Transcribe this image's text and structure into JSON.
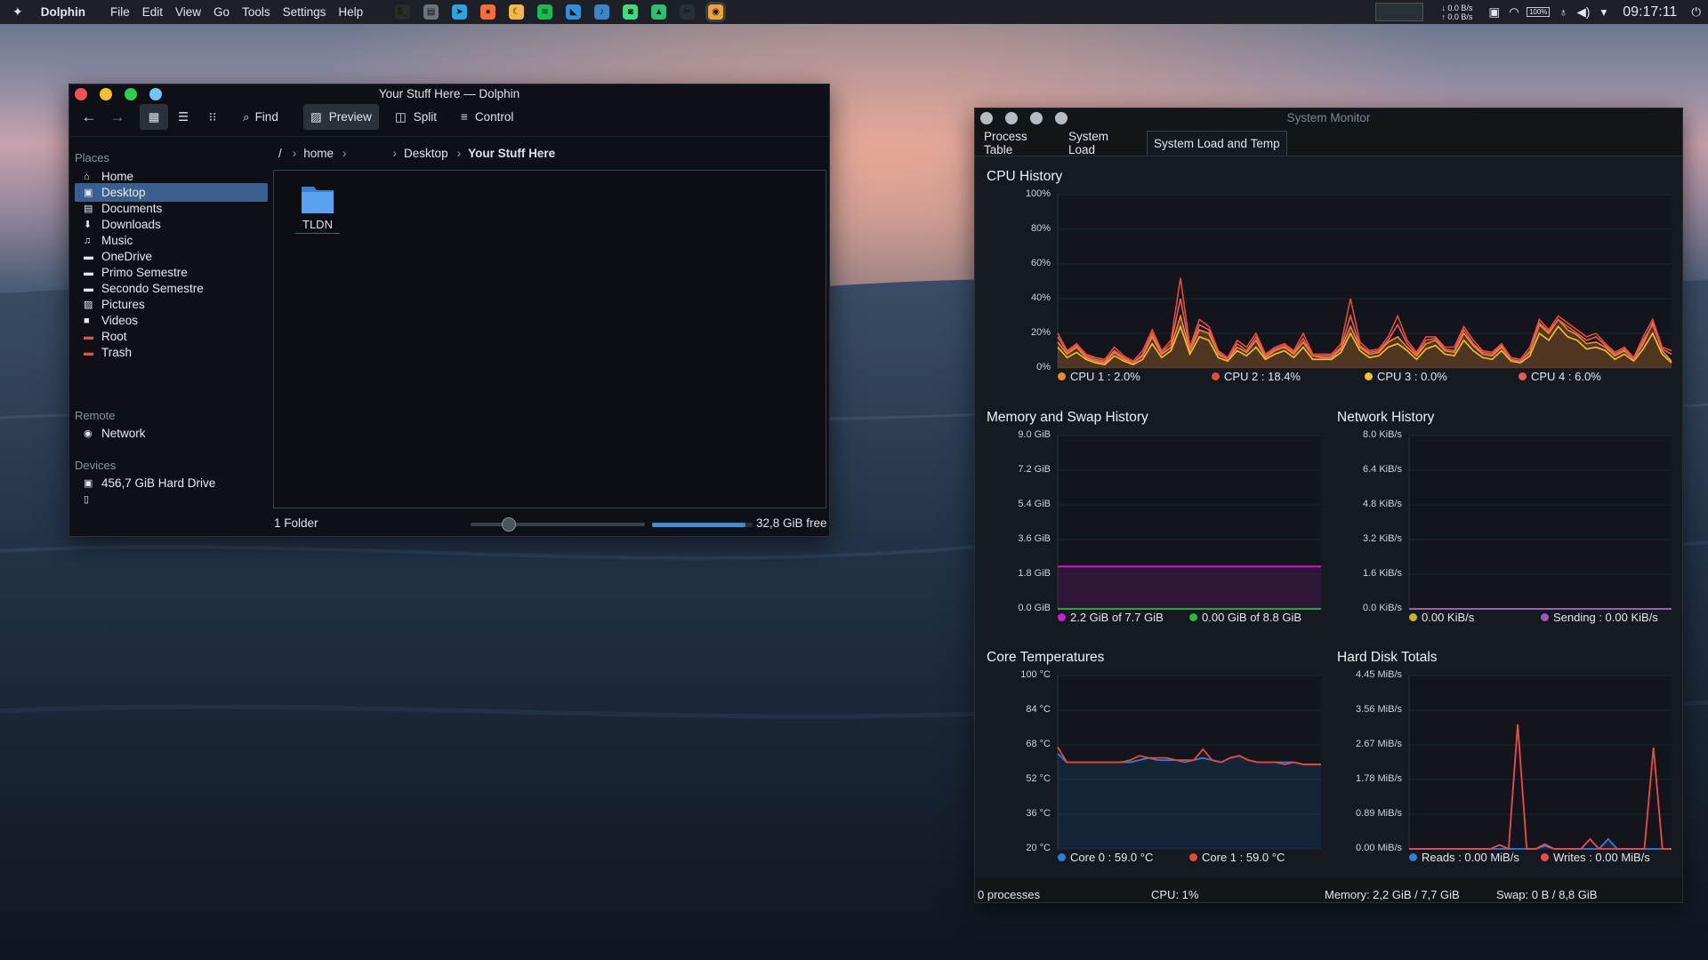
{
  "panel": {
    "app_name": "Dolphin",
    "menu": [
      "File",
      "Edit",
      "View",
      "Go",
      "Tools",
      "Settings",
      "Help"
    ],
    "net_down": "0.0 B/s",
    "net_up": "0.0 B/s",
    "battery": "100%",
    "clock": "09:17:11",
    "apps": [
      {
        "name": "terminal-icon",
        "color": "#2b2b2b",
        "glyph": "$_"
      },
      {
        "name": "files-icon",
        "color": "#6c737d",
        "glyph": "▤"
      },
      {
        "name": "telegram-icon",
        "color": "#2fa3df",
        "glyph": "➤"
      },
      {
        "name": "firefox-icon",
        "color": "#ff6b35",
        "glyph": "●"
      },
      {
        "name": "night-light-icon",
        "color": "#f2b84b",
        "glyph": "☾"
      },
      {
        "name": "spotify-icon",
        "color": "#1db954",
        "glyph": "≋"
      },
      {
        "name": "vscode-icon",
        "color": "#2f8fe0",
        "glyph": "◣"
      },
      {
        "name": "music-app-icon",
        "color": "#3a86c8",
        "glyph": "♪"
      },
      {
        "name": "android-icon",
        "color": "#3ddc84",
        "glyph": "◙"
      },
      {
        "name": "image-viewer-icon",
        "color": "#2fbf71",
        "glyph": "▲"
      },
      {
        "name": "scissors-icon",
        "color": "#2a2f36",
        "glyph": "✂"
      },
      {
        "name": "ubuntu-icon",
        "color": "#f0a23a",
        "glyph": "◉"
      }
    ]
  },
  "dolphin": {
    "title": "Your Stuff Here — Dolphin",
    "toolbar": {
      "find": "Find",
      "preview": "Preview",
      "split": "Split",
      "control": "Control"
    },
    "breadcrumb": [
      "/",
      "home",
      "Desktop",
      "Your Stuff Here"
    ],
    "places_header": "Places",
    "places": [
      {
        "label": "Home",
        "icon": "home-icon",
        "color": "#e6e9ed"
      },
      {
        "label": "Desktop",
        "icon": "desktop-icon",
        "color": "#e6e9ed"
      },
      {
        "label": "Documents",
        "icon": "document-icon",
        "color": "#e6e9ed"
      },
      {
        "label": "Downloads",
        "icon": "download-icon",
        "color": "#e6e9ed"
      },
      {
        "label": "Music",
        "icon": "music-icon",
        "color": "#e6e9ed"
      },
      {
        "label": "OneDrive",
        "icon": "folder-icon",
        "color": "#e6e9ed"
      },
      {
        "label": "Primo Semestre",
        "icon": "folder-icon",
        "color": "#e6e9ed"
      },
      {
        "label": "Secondo Semestre",
        "icon": "folder-icon",
        "color": "#e6e9ed"
      },
      {
        "label": "Pictures",
        "icon": "pictures-icon",
        "color": "#e6e9ed"
      },
      {
        "label": "Videos",
        "icon": "video-icon",
        "color": "#e6e9ed"
      },
      {
        "label": "Root",
        "icon": "root-folder-icon",
        "color": "#e0504a"
      },
      {
        "label": "Trash",
        "icon": "trash-icon",
        "color": "#e0504a"
      }
    ],
    "remote_header": "Remote",
    "remote": [
      {
        "label": "Network",
        "icon": "network-icon"
      }
    ],
    "devices_header": "Devices",
    "devices": [
      {
        "label": "456,7 GiB Hard Drive",
        "icon": "hard-drive-icon"
      },
      {
        "label": "",
        "icon": "removable-device-icon"
      }
    ],
    "files": [
      {
        "name": "TLDN",
        "type": "folder"
      }
    ],
    "status": {
      "count": "1 Folder",
      "free": "32,8 GiB free",
      "zoom_fraction": 0.22,
      "disk_used_fraction": 0.93
    }
  },
  "monitor": {
    "title": "System Monitor",
    "tabs": [
      "Process Table",
      "System Load",
      "System Load and Temp"
    ],
    "active_tab": 2,
    "status": {
      "processes": "0 processes",
      "cpu": "CPU: 1%",
      "memory": "Memory: 2,2 GiB / 7,7 GiB",
      "swap": "Swap: 0 B / 8,8 GiB"
    }
  },
  "chart_data": [
    {
      "type": "line",
      "title": "CPU History",
      "y_ticks": [
        "100%",
        "80%",
        "60%",
        "40%",
        "20%",
        "0%"
      ],
      "ylim": [
        0,
        100
      ],
      "series": [
        {
          "name": "CPU 1 : 2.0%",
          "color": "#f08d2a",
          "values": [
            15,
            8,
            12,
            6,
            4,
            3,
            9,
            5,
            3,
            7,
            18,
            8,
            12,
            30,
            10,
            22,
            20,
            8,
            5,
            12,
            9,
            16,
            6,
            10,
            12,
            8,
            15,
            7,
            6,
            6,
            11,
            24,
            12,
            8,
            9,
            15,
            18,
            12,
            7,
            14,
            16,
            10,
            9,
            20,
            13,
            8,
            7,
            12,
            5,
            4,
            9,
            25,
            20,
            28,
            22,
            19,
            14,
            15,
            12,
            7,
            10,
            5,
            14,
            26,
            10,
            4
          ]
        },
        {
          "name": "CPU 2 : 18.4%",
          "color": "#e84a3a",
          "values": [
            20,
            10,
            14,
            8,
            6,
            5,
            12,
            7,
            4,
            10,
            22,
            10,
            16,
            52,
            12,
            28,
            24,
            10,
            6,
            16,
            12,
            20,
            8,
            12,
            14,
            10,
            20,
            8,
            8,
            8,
            14,
            40,
            15,
            10,
            11,
            18,
            30,
            16,
            9,
            18,
            18,
            12,
            12,
            24,
            16,
            10,
            9,
            14,
            6,
            5,
            12,
            28,
            22,
            30,
            26,
            22,
            18,
            20,
            14,
            9,
            12,
            6,
            18,
            28,
            12,
            10
          ]
        },
        {
          "name": "CPU 3 : 0.0%",
          "color": "#f2c32b",
          "values": [
            12,
            6,
            9,
            5,
            3,
            2,
            7,
            4,
            2,
            5,
            14,
            6,
            10,
            24,
            8,
            18,
            16,
            6,
            4,
            10,
            7,
            12,
            5,
            8,
            10,
            6,
            12,
            5,
            5,
            5,
            9,
            20,
            10,
            6,
            7,
            12,
            14,
            10,
            5,
            11,
            13,
            8,
            7,
            16,
            10,
            6,
            5,
            10,
            4,
            3,
            7,
            20,
            16,
            24,
            18,
            16,
            11,
            12,
            10,
            5,
            8,
            4,
            11,
            20,
            8,
            3
          ]
        },
        {
          "name": "CPU 4 : 6.0%",
          "color": "#f05a5a",
          "values": [
            18,
            9,
            13,
            7,
            5,
            4,
            10,
            6,
            3,
            8,
            20,
            9,
            14,
            40,
            11,
            25,
            22,
            9,
            5,
            14,
            10,
            18,
            7,
            11,
            13,
            9,
            17,
            7,
            7,
            7,
            12,
            30,
            13,
            9,
            10,
            16,
            25,
            14,
            8,
            16,
            17,
            11,
            10,
            22,
            14,
            9,
            8,
            13,
            5,
            4,
            10,
            26,
            21,
            28,
            24,
            20,
            16,
            18,
            13,
            8,
            11,
            5,
            16,
            25,
            11,
            8
          ]
        }
      ]
    },
    {
      "type": "line",
      "title": "Memory and Swap History",
      "y_ticks": [
        "9.0 GiB",
        "7.2 GiB",
        "5.4 GiB",
        "3.6 GiB",
        "1.8 GiB",
        "0.0 GiB"
      ],
      "ylim": [
        0,
        9.0
      ],
      "series": [
        {
          "name": "2.2 GiB of 7.7 GiB",
          "color": "#d21bd2",
          "values": [
            2.2,
            2.2,
            2.2,
            2.2,
            2.2,
            2.2,
            2.2,
            2.2,
            2.2,
            2.2
          ]
        },
        {
          "name": "0.00 GiB of 8.8 GiB",
          "color": "#1fbf3a",
          "values": [
            0,
            0,
            0,
            0,
            0,
            0,
            0,
            0,
            0,
            0
          ]
        }
      ]
    },
    {
      "type": "line",
      "title": "Network History",
      "y_ticks": [
        "8.0 KiB/s",
        "6.4 KiB/s",
        "4.8 KiB/s",
        "3.2 KiB/s",
        "1.6 KiB/s",
        "0.0 KiB/s"
      ],
      "ylim": [
        0,
        8.0
      ],
      "series": [
        {
          "name": "0.00 KiB/s",
          "color": "#c9b52a",
          "values": [
            0,
            0,
            0,
            0,
            0,
            0,
            0,
            0,
            0,
            0
          ]
        },
        {
          "name": "Sending : 0.00 KiB/s",
          "color": "#9b59b6",
          "values": [
            0,
            0,
            0,
            0,
            0,
            0,
            0,
            0,
            0,
            0
          ]
        }
      ]
    },
    {
      "type": "line",
      "title": "Core Temperatures",
      "y_ticks": [
        "100 °C",
        "84 °C",
        "68 °C",
        "52 °C",
        "36 °C",
        "20 °C"
      ],
      "ylim": [
        20,
        100
      ],
      "series": [
        {
          "name": "Core 0 : 59.0 °C",
          "color": "#2f7fe0",
          "values": [
            64,
            60,
            60,
            60,
            60,
            60,
            60,
            60,
            60,
            61,
            62,
            61,
            61,
            61,
            60,
            61,
            62,
            61,
            60,
            62,
            63,
            61,
            60,
            60,
            60,
            60,
            60,
            59,
            59,
            59
          ]
        },
        {
          "name": "Core 1 : 59.0 °C",
          "color": "#e84a3a",
          "values": [
            67,
            60,
            60,
            60,
            60,
            60,
            60,
            60,
            61,
            63,
            62,
            62,
            62,
            61,
            61,
            61,
            66,
            61,
            60,
            62,
            63,
            61,
            60,
            60,
            60,
            59,
            60,
            59,
            59,
            59
          ]
        }
      ]
    },
    {
      "type": "line",
      "title": "Hard Disk Totals",
      "y_ticks": [
        "4.45 MiB/s",
        "3.56 MiB/s",
        "2.67 MiB/s",
        "1.78 MiB/s",
        "0.89 MiB/s",
        "0.00 MiB/s"
      ],
      "ylim": [
        0,
        4.45
      ],
      "series": [
        {
          "name": "Reads : 0.00 MiB/s",
          "color": "#2f7fe0",
          "values": [
            0,
            0,
            0,
            0,
            0,
            0,
            0,
            0,
            0,
            0,
            0,
            0,
            0,
            0,
            0,
            0.08,
            0,
            0,
            0,
            0,
            0,
            0,
            0.25,
            0,
            0,
            0,
            0,
            0,
            0,
            0
          ]
        },
        {
          "name": "Writes : 0.00 MiB/s",
          "color": "#f04a4a",
          "values": [
            0,
            0,
            0,
            0,
            0,
            0,
            0,
            0,
            0,
            0,
            0.1,
            0,
            3.2,
            0,
            0,
            0.12,
            0,
            0,
            0,
            0,
            0.25,
            0,
            0,
            0,
            0,
            0,
            0,
            2.6,
            0,
            0
          ]
        }
      ]
    }
  ]
}
